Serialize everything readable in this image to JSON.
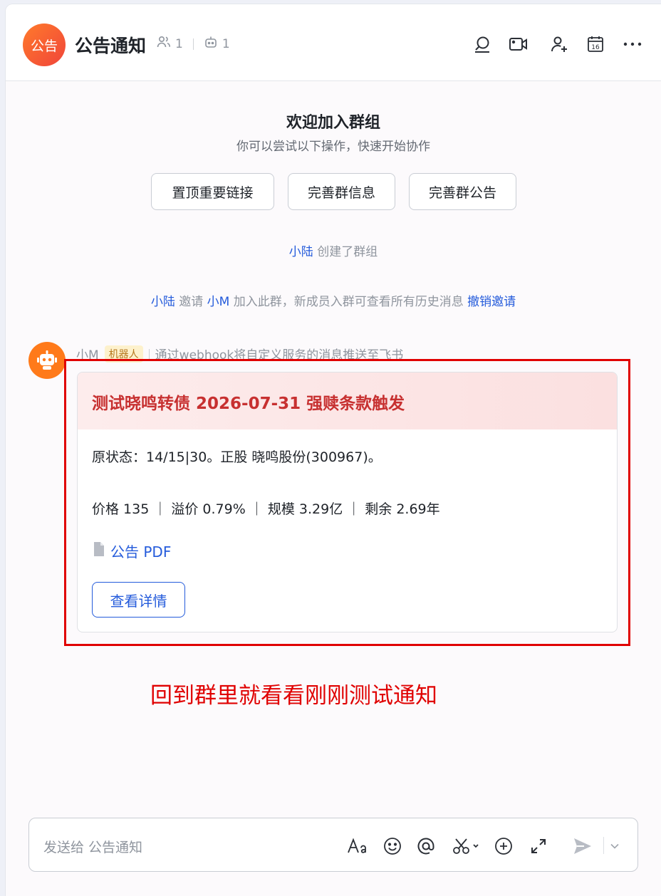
{
  "header": {
    "avatar_text": "公告",
    "title": "公告通知",
    "member_count": "1",
    "bot_count": "1"
  },
  "welcome": {
    "title": "欢迎加入群组",
    "subtitle": "你可以尝试以下操作，快速开始协作",
    "actions": [
      "置顶重要链接",
      "完善群信息",
      "完善群公告"
    ]
  },
  "system_messages": {
    "created_user": "小陆",
    "created_text": "创建了群组",
    "invite_user": "小陆",
    "invite_verb": "邀请",
    "invitee": "小M",
    "invite_text": "加入此群，新成员入群可查看所有历史消息",
    "revoke_link": "撤销邀请"
  },
  "message": {
    "sender": "小M",
    "bot_tag": "机器人",
    "description": "通过webhook将自定义服务的消息推送至飞书",
    "card": {
      "title": "测试晓鸣转债 2026-07-31 强赎条款触发",
      "line1": "原状态：14/15|30。正股 晓鸣股份(300967)。",
      "line2": "价格 135 ｜ 溢价 0.79% ｜ 规模 3.29亿 ｜ 剩余 2.69年",
      "link_label": "公告 PDF",
      "button_label": "查看详情"
    }
  },
  "annotation": {
    "text": "回到群里就看看刚刚测试通知",
    "color": "#e00000"
  },
  "composer": {
    "placeholder": "发送给 公告通知"
  },
  "colors": {
    "accent": "#245bdb",
    "card_title": "#c73030",
    "avatar_gradient_start": "#ff7a2b",
    "avatar_gradient_end": "#f0453a"
  }
}
